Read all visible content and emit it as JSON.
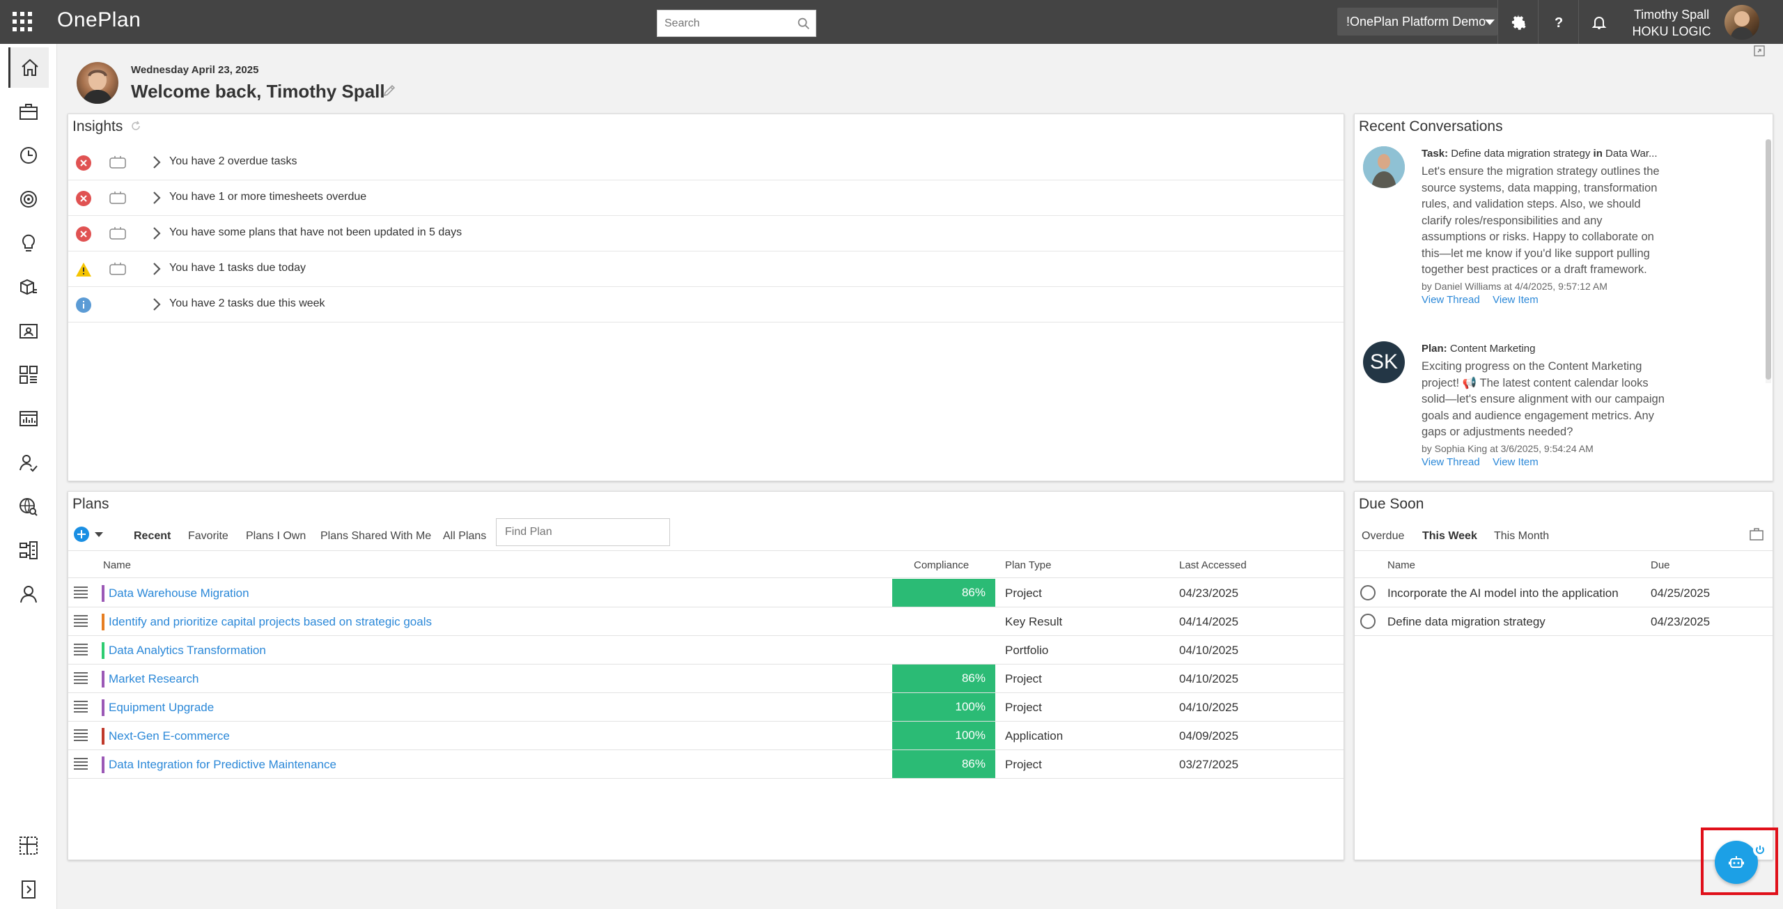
{
  "app": {
    "title": "OnePlan"
  },
  "search": {
    "placeholder": "Search"
  },
  "tenant": {
    "label": "!OnePlan Platform Demo"
  },
  "user": {
    "name": "Timothy Spall",
    "org": "HOKU LOGIC"
  },
  "header": {
    "date": "Wednesday April 23, 2025",
    "welcome": "Welcome back, Timothy Spall"
  },
  "insights": {
    "title": "Insights",
    "items": [
      {
        "status": "error",
        "text": "You have 2 overdue tasks"
      },
      {
        "status": "error",
        "text": "You have 1 or more timesheets overdue"
      },
      {
        "status": "error",
        "text": "You have some plans that have not been updated in 5 days"
      },
      {
        "status": "warning",
        "text": "You have 1 tasks due today"
      },
      {
        "status": "info",
        "text": "You have 2 tasks due this week"
      }
    ]
  },
  "conversations": {
    "title": "Recent Conversations",
    "items": [
      {
        "kind": "Task:",
        "subject": "Define data migration strategy",
        "in_label": "in",
        "context": "Data War...",
        "text": "Let's ensure the migration strategy outlines the source systems, data mapping, transformation rules, and validation steps. Also, we should clarify roles/responsibilities and any assumptions or risks. Happy to collaborate on this—let me know if you'd like support pulling together best practices or a draft framework.",
        "by": "by Daniel Williams at 4/4/2025, 9:57:12 AM",
        "view_thread": "View Thread",
        "view_item": "View Item"
      },
      {
        "kind": "Plan:",
        "subject": "Content Marketing",
        "initials": "SK",
        "text": "Exciting progress on the Content Marketing project! 📢 The latest content calendar looks solid—let's ensure alignment with our campaign goals and audience engagement metrics. Any gaps or adjustments needed?",
        "by": "by Sophia King at 3/6/2025, 9:54:24 AM",
        "view_thread": "View Thread",
        "view_item": "View Item"
      }
    ]
  },
  "plans": {
    "title": "Plans",
    "tabs": [
      "Recent",
      "Favorite",
      "Plans I Own",
      "Plans Shared With Me",
      "All Plans"
    ],
    "find_placeholder": "Find Plan",
    "columns": {
      "name": "Name",
      "compliance": "Compliance",
      "type": "Plan Type",
      "accessed": "Last Accessed"
    },
    "rows": [
      {
        "name": "Data Warehouse Migration",
        "color": "#9b59b6",
        "compliance": "86%",
        "type": "Project",
        "accessed": "04/23/2025"
      },
      {
        "name": "Identify and prioritize capital projects based on strategic goals",
        "color": "#e67e22",
        "compliance": "",
        "type": "Key Result",
        "accessed": "04/14/2025"
      },
      {
        "name": "Data Analytics Transformation",
        "color": "#2ecc71",
        "compliance": "",
        "type": "Portfolio",
        "accessed": "04/10/2025"
      },
      {
        "name": "Market Research",
        "color": "#9b59b6",
        "compliance": "86%",
        "type": "Project",
        "accessed": "04/10/2025"
      },
      {
        "name": "Equipment Upgrade",
        "color": "#9b59b6",
        "compliance": "100%",
        "type": "Project",
        "accessed": "04/10/2025"
      },
      {
        "name": "Next-Gen E-commerce",
        "color": "#c0392b",
        "compliance": "100%",
        "type": "Application",
        "accessed": "04/09/2025"
      },
      {
        "name": "Data Integration for Predictive Maintenance",
        "color": "#9b59b6",
        "compliance": "86%",
        "type": "Project",
        "accessed": "03/27/2025"
      }
    ]
  },
  "due_soon": {
    "title": "Due Soon",
    "tabs": [
      "Overdue",
      "This Week",
      "This Month"
    ],
    "columns": {
      "name": "Name",
      "due": "Due"
    },
    "rows": [
      {
        "name": "Incorporate the AI model into the application",
        "due": "04/25/2025"
      },
      {
        "name": "Define data migration strategy",
        "due": "04/23/2025"
      }
    ]
  },
  "colors": {
    "topbar": "#444444",
    "accent": "#2b88d8",
    "compliance": "#2bbb75",
    "error": "#e05252",
    "warning": "#f5c400",
    "info": "#5b9bd5"
  },
  "icons": [
    "waffle-icon",
    "search-icon",
    "gear-icon",
    "help-icon",
    "bell-icon",
    "home-icon",
    "briefcase-icon",
    "clock-icon",
    "target-icon",
    "lightbulb-icon",
    "boxes-icon",
    "contact-card-icon",
    "dashboard-icon",
    "report-icon",
    "people-icon",
    "globe-search-icon",
    "org-chart-icon",
    "person-icon",
    "layout-icon",
    "expand-nav-icon",
    "bot-icon"
  ]
}
